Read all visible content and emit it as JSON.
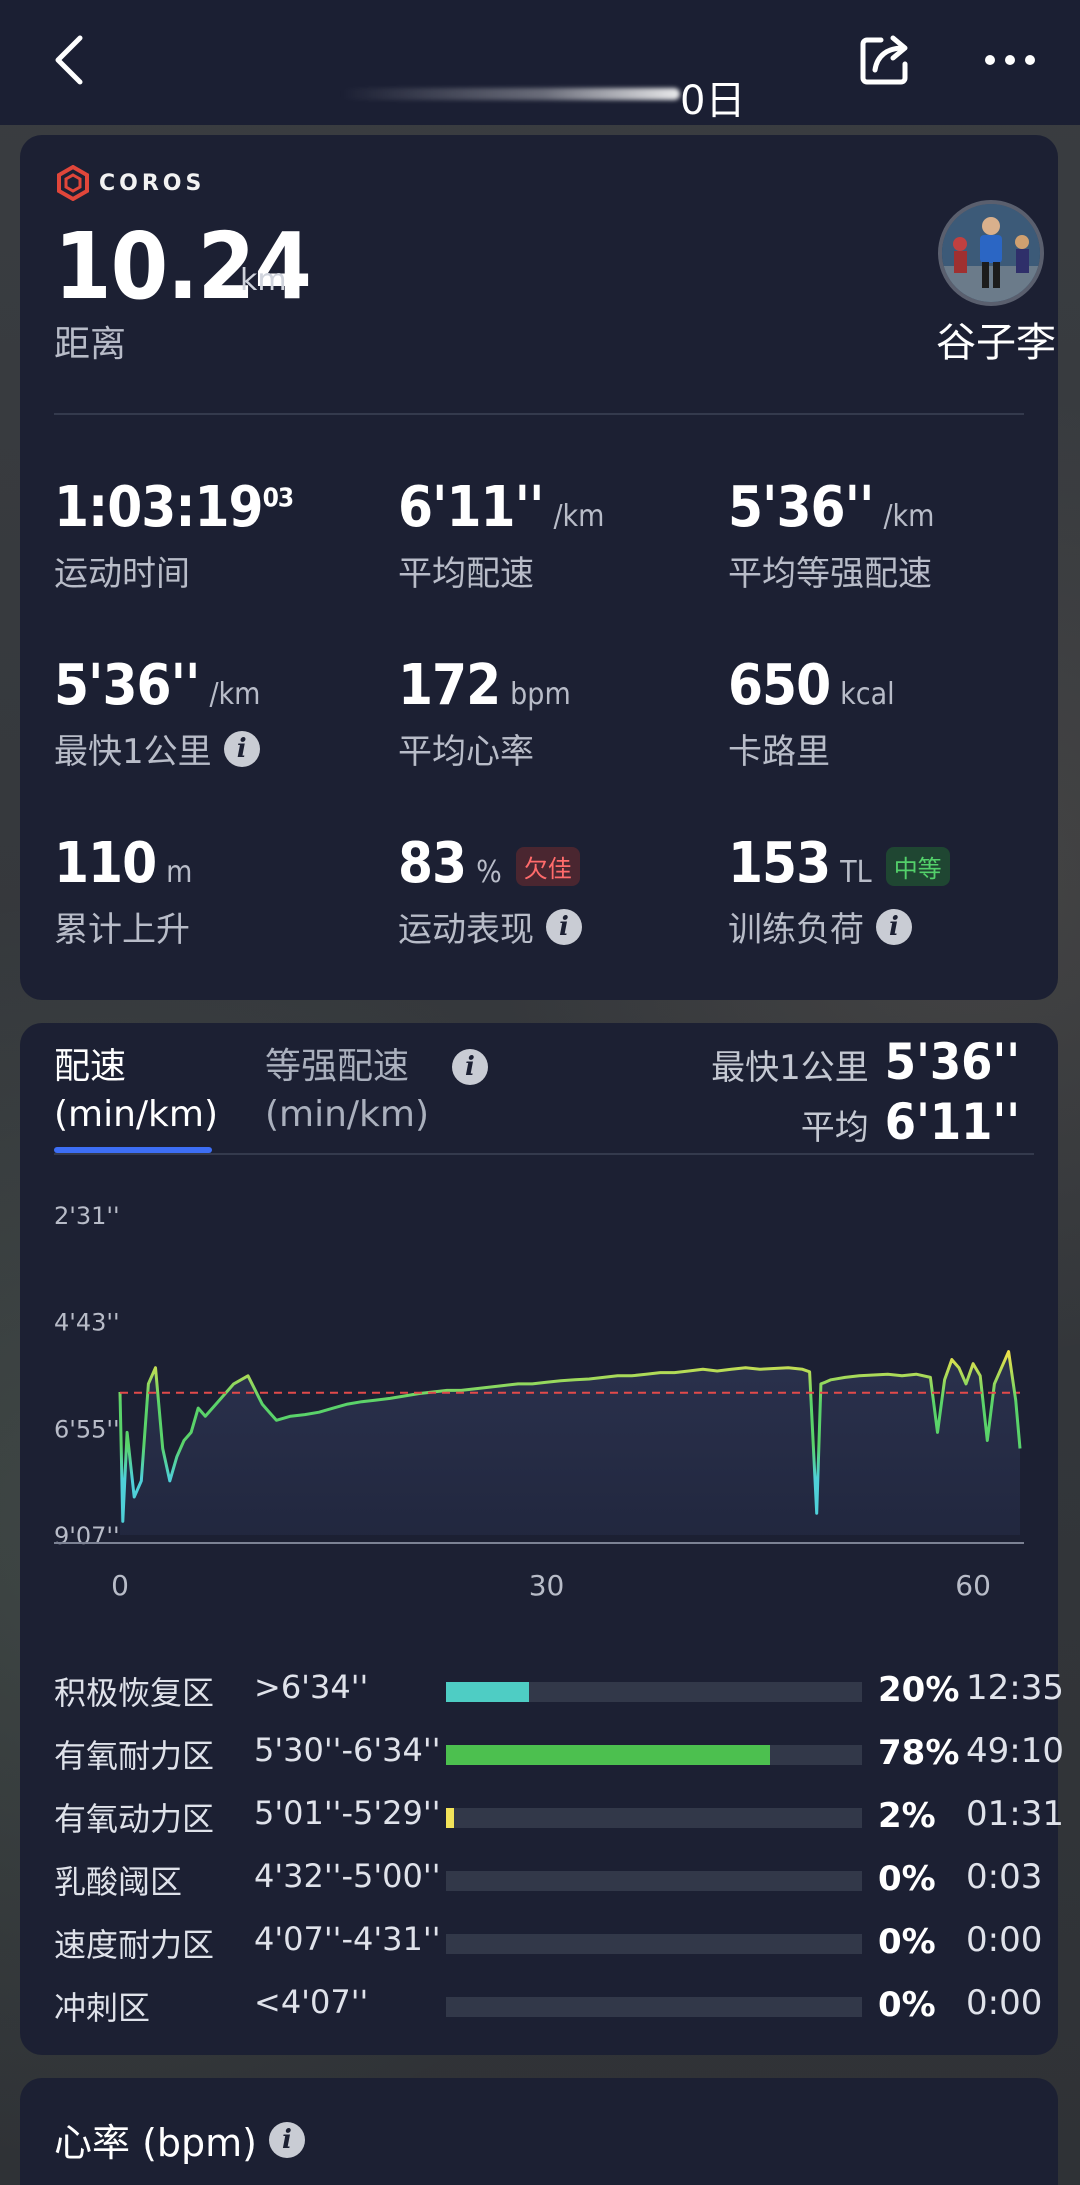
{
  "header": {
    "title": "0日"
  },
  "summary": {
    "brand": "COROS",
    "distance_value": "10.24",
    "distance_unit": "km",
    "distance_label": "距离",
    "username": "谷子李"
  },
  "stats": [
    {
      "value": "1:03:19",
      "sup": "03",
      "unit": "",
      "label": "运动时间",
      "badge": "",
      "badge_type": "",
      "info": false
    },
    {
      "value": "6'11''",
      "sup": "",
      "unit": "/km",
      "label": "平均配速",
      "badge": "",
      "badge_type": "",
      "info": false
    },
    {
      "value": "5'36''",
      "sup": "",
      "unit": "/km",
      "label": "平均等强配速",
      "badge": "",
      "badge_type": "",
      "info": false
    },
    {
      "value": "5'36''",
      "sup": "",
      "unit": "/km",
      "label": "最快1公里",
      "badge": "",
      "badge_type": "",
      "info": true
    },
    {
      "value": "172",
      "sup": "",
      "unit": "bpm",
      "label": "平均心率",
      "badge": "",
      "badge_type": "",
      "info": false
    },
    {
      "value": "650",
      "sup": "",
      "unit": "kcal",
      "label": "卡路里",
      "badge": "",
      "badge_type": "",
      "info": false
    },
    {
      "value": "110",
      "sup": "",
      "unit": "m",
      "label": "累计上升",
      "badge": "",
      "badge_type": "",
      "info": false
    },
    {
      "value": "83",
      "sup": "",
      "unit": "%",
      "label": "运动表现",
      "badge": "欠佳",
      "badge_type": "red",
      "info": true
    },
    {
      "value": "153",
      "sup": "",
      "unit": "TL",
      "label": "训练负荷",
      "badge": "中等",
      "badge_type": "green",
      "info": true
    }
  ],
  "pace_card": {
    "tab_active_line1": "配速",
    "tab_active_line2": "(min/km)",
    "tab_inactive_line1": "等强配速",
    "tab_inactive_line2": "(min/km)",
    "fastest_label": "最快1公里",
    "fastest_value": "5'36''",
    "avg_label": "平均",
    "avg_value": "6'11''"
  },
  "chart_data": {
    "type": "line",
    "title": "",
    "xlabel": "",
    "ylabel": "配速 (min/km)",
    "y_ticks": [
      "2'31''",
      "4'43''",
      "6'55''",
      "9'07''"
    ],
    "y_tick_seconds": [
      151,
      283,
      415,
      547
    ],
    "y_inverted": true,
    "x_ticks": [
      0,
      30,
      60
    ],
    "xlim": [
      0,
      63.3
    ],
    "average_line_seconds": 371,
    "average_line_label": "6'11''",
    "series": [
      {
        "x": [
          0,
          0.2,
          0.5,
          1,
          1.5,
          2,
          2.5,
          3,
          3.5,
          4,
          4.5,
          5,
          5.5,
          6,
          7,
          8,
          9,
          10,
          10.5,
          11,
          12,
          13,
          14,
          15,
          16,
          17,
          18,
          19,
          20,
          21,
          22,
          23,
          24,
          25,
          26,
          27,
          28,
          29,
          30,
          31,
          32,
          33,
          34,
          35,
          36,
          37,
          38,
          39,
          40,
          41,
          42,
          43,
          44,
          45,
          46,
          47,
          48,
          48.5,
          49,
          49.3,
          49.6,
          50,
          51,
          52,
          53,
          54,
          55,
          56,
          57,
          57.5,
          58,
          58.5,
          59,
          59.5,
          60,
          60.5,
          61,
          61.5,
          62,
          62.5,
          63,
          63.3
        ],
        "values": [
          370,
          530,
          420,
          500,
          480,
          360,
          340,
          440,
          480,
          450,
          430,
          420,
          390,
          400,
          380,
          360,
          350,
          385,
          395,
          405,
          400,
          398,
          395,
          390,
          385,
          382,
          380,
          378,
          375,
          372,
          370,
          368,
          368,
          366,
          364,
          362,
          360,
          360,
          358,
          356,
          355,
          354,
          352,
          350,
          350,
          348,
          346,
          346,
          344,
          342,
          344,
          342,
          340,
          342,
          341,
          340,
          342,
          345,
          520,
          360,
          358,
          355,
          352,
          350,
          349,
          348,
          350,
          348,
          352,
          420,
          355,
          330,
          340,
          360,
          335,
          350,
          430,
          360,
          340,
          320,
          380,
          440
        ]
      }
    ],
    "colors": {
      "high": "#f0e14a",
      "mid": "#5ad36a",
      "low": "#4fd0d8",
      "average": "#e24a4a"
    }
  },
  "zones": [
    {
      "name": "积极恢复区",
      "range": ">6'34''",
      "pct_value": 20,
      "pct": "20%",
      "time": "12:35",
      "color": "#4ecdc4"
    },
    {
      "name": "有氧耐力区",
      "range": "5'30''-6'34''",
      "pct_value": 78,
      "pct": "78%",
      "time": "49:10",
      "color": "#4cc04f"
    },
    {
      "name": "有氧动力区",
      "range": "5'01''-5'29''",
      "pct_value": 2,
      "pct": "2%",
      "time": "01:31",
      "color": "#f2e35a"
    },
    {
      "name": "乳酸阈区",
      "range": "4'32''-5'00''",
      "pct_value": 0,
      "pct": "0%",
      "time": "0:03",
      "color": "#f0a040"
    },
    {
      "name": "速度耐力区",
      "range": "4'07''-4'31''",
      "pct_value": 0,
      "pct": "0%",
      "time": "0:00",
      "color": "#f06a40"
    },
    {
      "name": "冲刺区",
      "range": "<4'07''",
      "pct_value": 0,
      "pct": "0%",
      "time": "0:00",
      "color": "#e04040"
    }
  ],
  "hr_card": {
    "title": "心率 (bpm)"
  }
}
